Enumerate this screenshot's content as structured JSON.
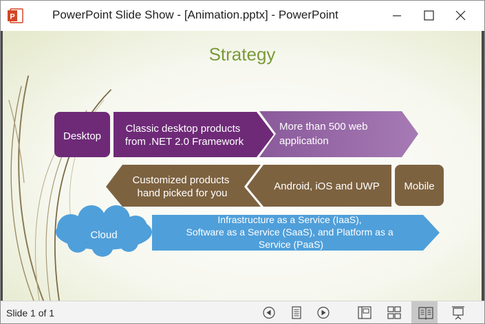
{
  "window": {
    "title": "PowerPoint Slide Show - [Animation.pptx] - PowerPoint",
    "app_icon_letter": "P",
    "brand_color": "#d24726"
  },
  "slide": {
    "title": "Strategy",
    "rows": {
      "desktop": {
        "label": "Desktop",
        "current": [
          "Classic desktop products",
          "from .NET 2.0 Framework"
        ],
        "future": [
          "More than 500 web",
          "application"
        ]
      },
      "mobile": {
        "label": "Mobile",
        "current": "Android, iOS and UWP",
        "future": [
          "Customized products",
          "hand picked for you"
        ]
      },
      "cloud": {
        "label": "Cloud",
        "services": [
          "Infrastructure as a Service (IaaS),",
          "Software as a Service (SaaS), and Platform as a",
          "Service (PaaS)"
        ]
      }
    },
    "colors": {
      "title": "#7a9a3a",
      "desktop": "#6e2a77",
      "desktop_light": "#8a5a9a",
      "mobile": "#7d6240",
      "cloud": "#4f9fda"
    }
  },
  "statusbar": {
    "slide_counter": "Slide 1 of 1"
  }
}
